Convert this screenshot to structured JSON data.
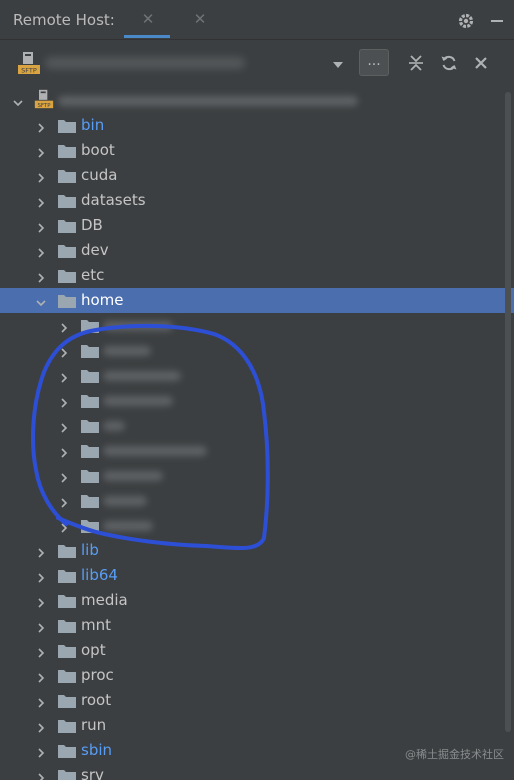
{
  "header": {
    "title": "Remote Host:",
    "tabs": [
      {
        "close_glyph": "✕"
      },
      {
        "close_glyph": "✕"
      }
    ],
    "icons": [
      "gear-icon",
      "minimize-icon"
    ]
  },
  "toolbar": {
    "sftp_icon": "sftp-server-icon",
    "browse_label": "...",
    "icons": [
      "dropdown-arrow-icon",
      "collapse-all-icon",
      "refresh-icon",
      "close-icon"
    ]
  },
  "tree": {
    "root": {
      "icon": "sftp-server-icon",
      "expanded": true
    },
    "items": [
      {
        "label": "bin",
        "link": true
      },
      {
        "label": "boot",
        "link": false
      },
      {
        "label": "cuda",
        "link": false
      },
      {
        "label": "datasets",
        "link": false
      },
      {
        "label": "DB",
        "link": false
      },
      {
        "label": "dev",
        "link": false
      },
      {
        "label": "etc",
        "link": false
      },
      {
        "label": "home",
        "link": false,
        "expanded": true,
        "selected": true
      },
      {
        "label": "lib",
        "link": true
      },
      {
        "label": "lib64",
        "link": true
      },
      {
        "label": "media",
        "link": false
      },
      {
        "label": "mnt",
        "link": false
      },
      {
        "label": "opt",
        "link": false
      },
      {
        "label": "proc",
        "link": false
      },
      {
        "label": "root",
        "link": false
      },
      {
        "label": "run",
        "link": false
      },
      {
        "label": "sbin",
        "link": true
      },
      {
        "label": "srv",
        "link": false
      }
    ]
  },
  "colors": {
    "background": "#3c3f41",
    "selection": "#4b6eaf",
    "link": "#589df6",
    "text": "#c5c5c5",
    "annotation": "#2d4fd6"
  },
  "watermark": "@稀土掘金技术社区"
}
